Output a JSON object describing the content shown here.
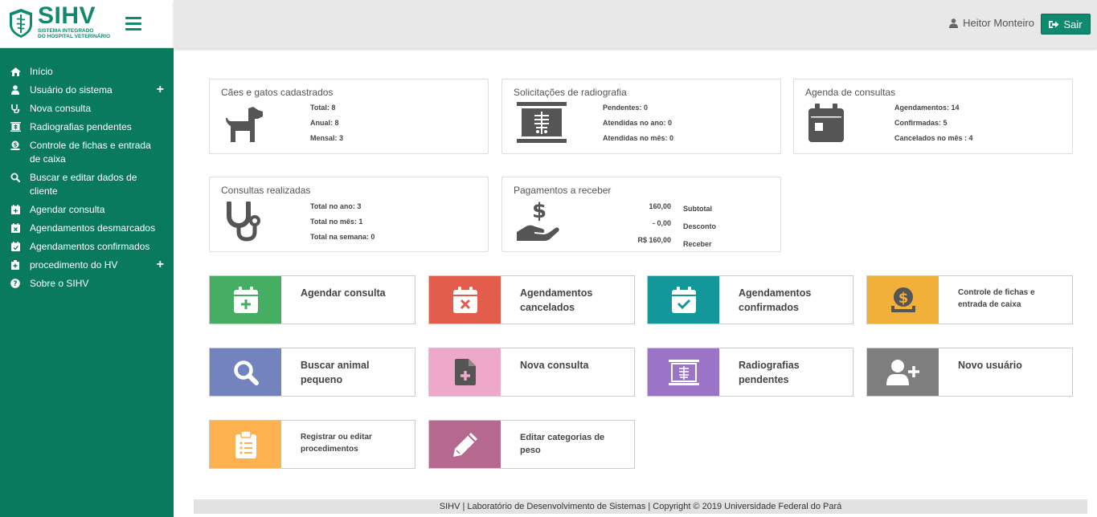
{
  "brand": {
    "name": "SIHV",
    "subtitle_line1": "SISTEMA INTEGRADO",
    "subtitle_line2": "DO HOSPITAL VETERINÁRIO",
    "color": "#0f8a6e"
  },
  "header": {
    "user_name": "Heitor Monteiro",
    "logout_label": "Sair"
  },
  "sidebar": {
    "items": [
      {
        "label": "Início",
        "icon": "home-icon"
      },
      {
        "label": "Usuário do sistema",
        "icon": "user-icon",
        "expandable": true
      },
      {
        "label": "Nova consulta",
        "icon": "stethoscope-icon"
      },
      {
        "label": "Radiografias pendentes",
        "icon": "xray-icon"
      },
      {
        "label": "Controle de fichas e entrada de caixa",
        "icon": "cash-register-icon"
      },
      {
        "label": "Buscar e editar dados de cliente",
        "icon": "search-icon"
      },
      {
        "label": "Agendar consulta",
        "icon": "calendar-plus-icon"
      },
      {
        "label": "Agendamentos desmarcados",
        "icon": "calendar-times-icon"
      },
      {
        "label": "Agendamentos confirmados",
        "icon": "calendar-check-icon"
      },
      {
        "label": "procedimento do HV",
        "icon": "procedure-icon",
        "expandable": true
      },
      {
        "label": "Sobre o SIHV",
        "icon": "question-icon"
      }
    ]
  },
  "cards": {
    "pets": {
      "title": "Cães e gatos cadastrados",
      "stats": [
        "Total: 8",
        "Anual: 8",
        "Mensal: 3"
      ]
    },
    "radiography": {
      "title": "Solicitações de radiografia",
      "stats": [
        "Pendentes: 0",
        "Atendidas no ano: 0",
        "Atendidas no mês: 0"
      ]
    },
    "schedule": {
      "title": "Agenda de consultas",
      "stats": [
        "Agendamentos: 14",
        "Confirmadas: 5",
        "Cancelados no mês : 4"
      ]
    },
    "consults": {
      "title": "Consultas realizadas",
      "stats": [
        "Total no ano: 3",
        "Total no mês: 1",
        "Total na semana: 0"
      ]
    },
    "payments": {
      "title": "Pagamentos a receber",
      "values": [
        "160,00",
        "- 0,00",
        "R$ 160,00"
      ],
      "labels": [
        "Subtotal",
        "Desconto",
        "Receber"
      ]
    }
  },
  "tiles": [
    {
      "label": "Agendar consulta",
      "color": "#46ae63",
      "icon": "calendar-plus-icon"
    },
    {
      "label": "Agendamentos cancelados",
      "color": "#e25d4c",
      "icon": "calendar-times-icon"
    },
    {
      "label": "Agendamentos confirmados",
      "color": "#13979a",
      "icon": "calendar-check-icon"
    },
    {
      "label": "Controle de fichas e entrada de caixa",
      "color": "#f0b03a",
      "icon": "cash-register-icon"
    },
    {
      "label": "Buscar animal pequeno",
      "color": "#7383bd",
      "icon": "search-icon"
    },
    {
      "label": "Nova consulta",
      "color": "#eea8c9",
      "icon": "file-medical-icon"
    },
    {
      "label": "Radiografias pendentes",
      "color": "#9b74c8",
      "icon": "xray-icon"
    },
    {
      "label": "Novo usuário",
      "color": "#7e7e7e",
      "icon": "user-plus-icon"
    },
    {
      "label": "Registrar ou editar procedimentos",
      "color": "#fdb24f",
      "icon": "clipboard-list-icon"
    },
    {
      "label": "Editar categorias de peso",
      "color": "#b5698f",
      "icon": "pencil-icon"
    }
  ],
  "footer": {
    "text": "SIHV | Laboratório de Desenvolvimento de Sistemas | Copyright © 2019 Universidade Federal do Pará"
  }
}
